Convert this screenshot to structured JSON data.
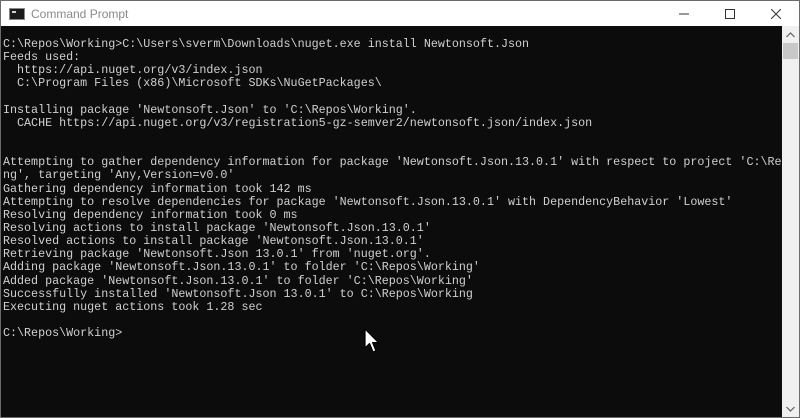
{
  "window": {
    "title": "Command Prompt"
  },
  "console": {
    "lines": [
      "C:\\Repos\\Working>C:\\Users\\sverm\\Downloads\\nuget.exe install Newtonsoft.Json",
      "Feeds used:",
      "  https://api.nuget.org/v3/index.json",
      "  C:\\Program Files (x86)\\Microsoft SDKs\\NuGetPackages\\",
      "",
      "Installing package 'Newtonsoft.Json' to 'C:\\Repos\\Working'.",
      "  CACHE https://api.nuget.org/v3/registration5-gz-semver2/newtonsoft.json/index.json",
      "",
      "",
      "Attempting to gather dependency information for package 'Newtonsoft.Json.13.0.1' with respect to project 'C:\\Repos\\Worki",
      "ng', targeting 'Any,Version=v0.0'",
      "Gathering dependency information took 142 ms",
      "Attempting to resolve dependencies for package 'Newtonsoft.Json.13.0.1' with DependencyBehavior 'Lowest'",
      "Resolving dependency information took 0 ms",
      "Resolving actions to install package 'Newtonsoft.Json.13.0.1'",
      "Resolved actions to install package 'Newtonsoft.Json.13.0.1'",
      "Retrieving package 'Newtonsoft.Json 13.0.1' from 'nuget.org'.",
      "Adding package 'Newtonsoft.Json.13.0.1' to folder 'C:\\Repos\\Working'",
      "Added package 'Newtonsoft.Json.13.0.1' to folder 'C:\\Repos\\Working'",
      "Successfully installed 'Newtonsoft.Json 13.0.1' to C:\\Repos\\Working",
      "Executing nuget actions took 1.28 sec",
      "",
      "C:\\Repos\\Working>"
    ]
  },
  "icons": {
    "app": "console-icon",
    "minimize": "minimize-icon",
    "maximize": "maximize-icon",
    "close": "close-icon",
    "pointer": "mouse-pointer-icon"
  },
  "colors": {
    "background": "#0c0c0c",
    "text": "#d0d0d0",
    "titlebar": "#ffffff",
    "title_text": "#8a8a8a"
  }
}
